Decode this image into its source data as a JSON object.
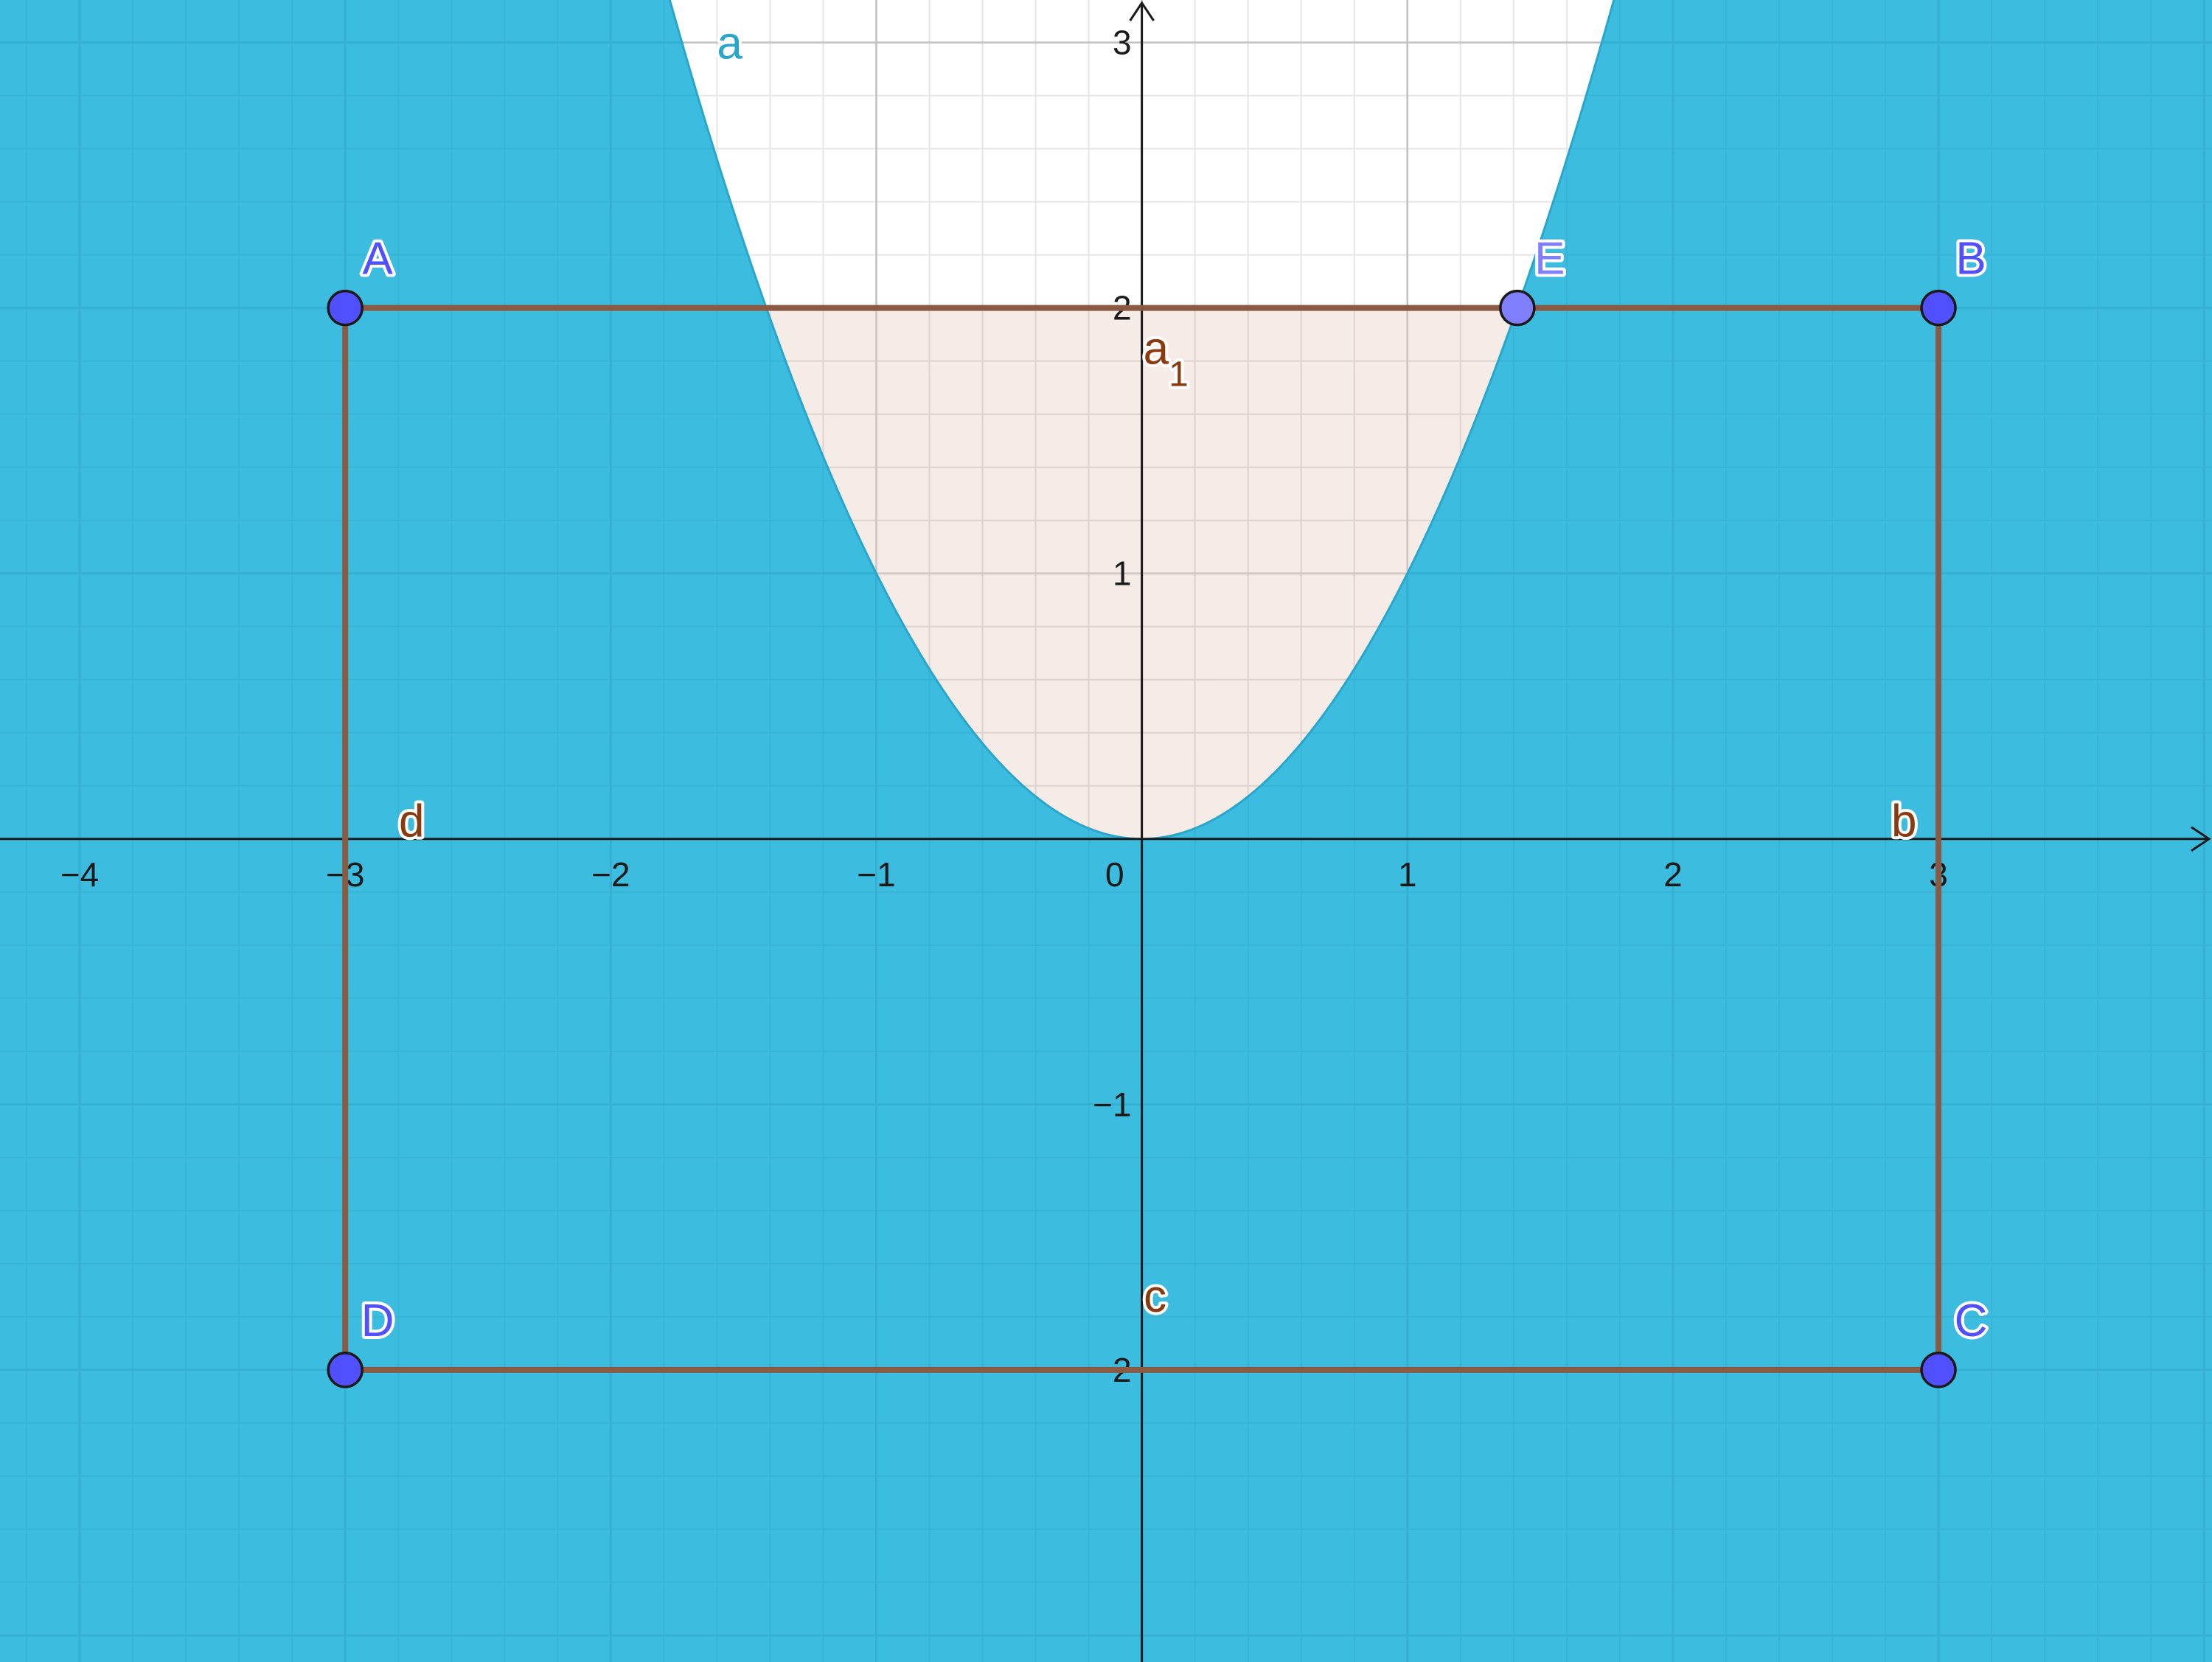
{
  "axes": {
    "x_range": [
      -4.3,
      4.03
    ],
    "y_range": [
      -3.1,
      3.16
    ],
    "x_ticks": [
      {
        "value": -4,
        "label": "−4"
      },
      {
        "value": -3,
        "label": "−3"
      },
      {
        "value": -2,
        "label": "−2"
      },
      {
        "value": -1,
        "label": "−1"
      },
      {
        "value": 1,
        "label": "1"
      },
      {
        "value": 2,
        "label": "2"
      },
      {
        "value": 3,
        "label": "3"
      }
    ],
    "y_ticks": [
      {
        "value": -2,
        "label": "−2"
      },
      {
        "value": -1,
        "label": "−1"
      },
      {
        "value": 1,
        "label": "1"
      },
      {
        "value": 2,
        "label": "2"
      },
      {
        "value": 3,
        "label": "3"
      }
    ],
    "origin_label": "0",
    "minor_grid_step": 0.2,
    "grid": true
  },
  "colors": {
    "fill": "#3cbcdf",
    "curve": "#29a6cc",
    "region": "#f4e9e5",
    "rectangle": "#8b5a43",
    "point": "#5050ff",
    "point_light": "#8080ff",
    "label_brown": "#8b3a0e",
    "axis": "#1a1a1a"
  },
  "curve": {
    "label": "a",
    "a": 1,
    "label_at": [
      -1.6,
      3.0
    ]
  },
  "region": {
    "label_main": "a",
    "label_sub": "1",
    "y_top": 2
  },
  "points": [
    {
      "name": "A",
      "x": -3,
      "y": 2,
      "style": "strong"
    },
    {
      "name": "B",
      "x": 3,
      "y": 2,
      "style": "strong"
    },
    {
      "name": "C",
      "x": 3,
      "y": -2,
      "style": "strong"
    },
    {
      "name": "D",
      "x": -3,
      "y": -2,
      "style": "strong"
    },
    {
      "name": "E",
      "x": 1.414,
      "y": 2,
      "style": "light"
    }
  ],
  "segments": [
    {
      "label": "b",
      "label_at": [
        2.87,
        0.07
      ]
    },
    {
      "label": "c",
      "label_at": [
        0.05,
        -1.72
      ]
    },
    {
      "label": "d",
      "label_at": [
        -2.75,
        0.07
      ]
    }
  ]
}
